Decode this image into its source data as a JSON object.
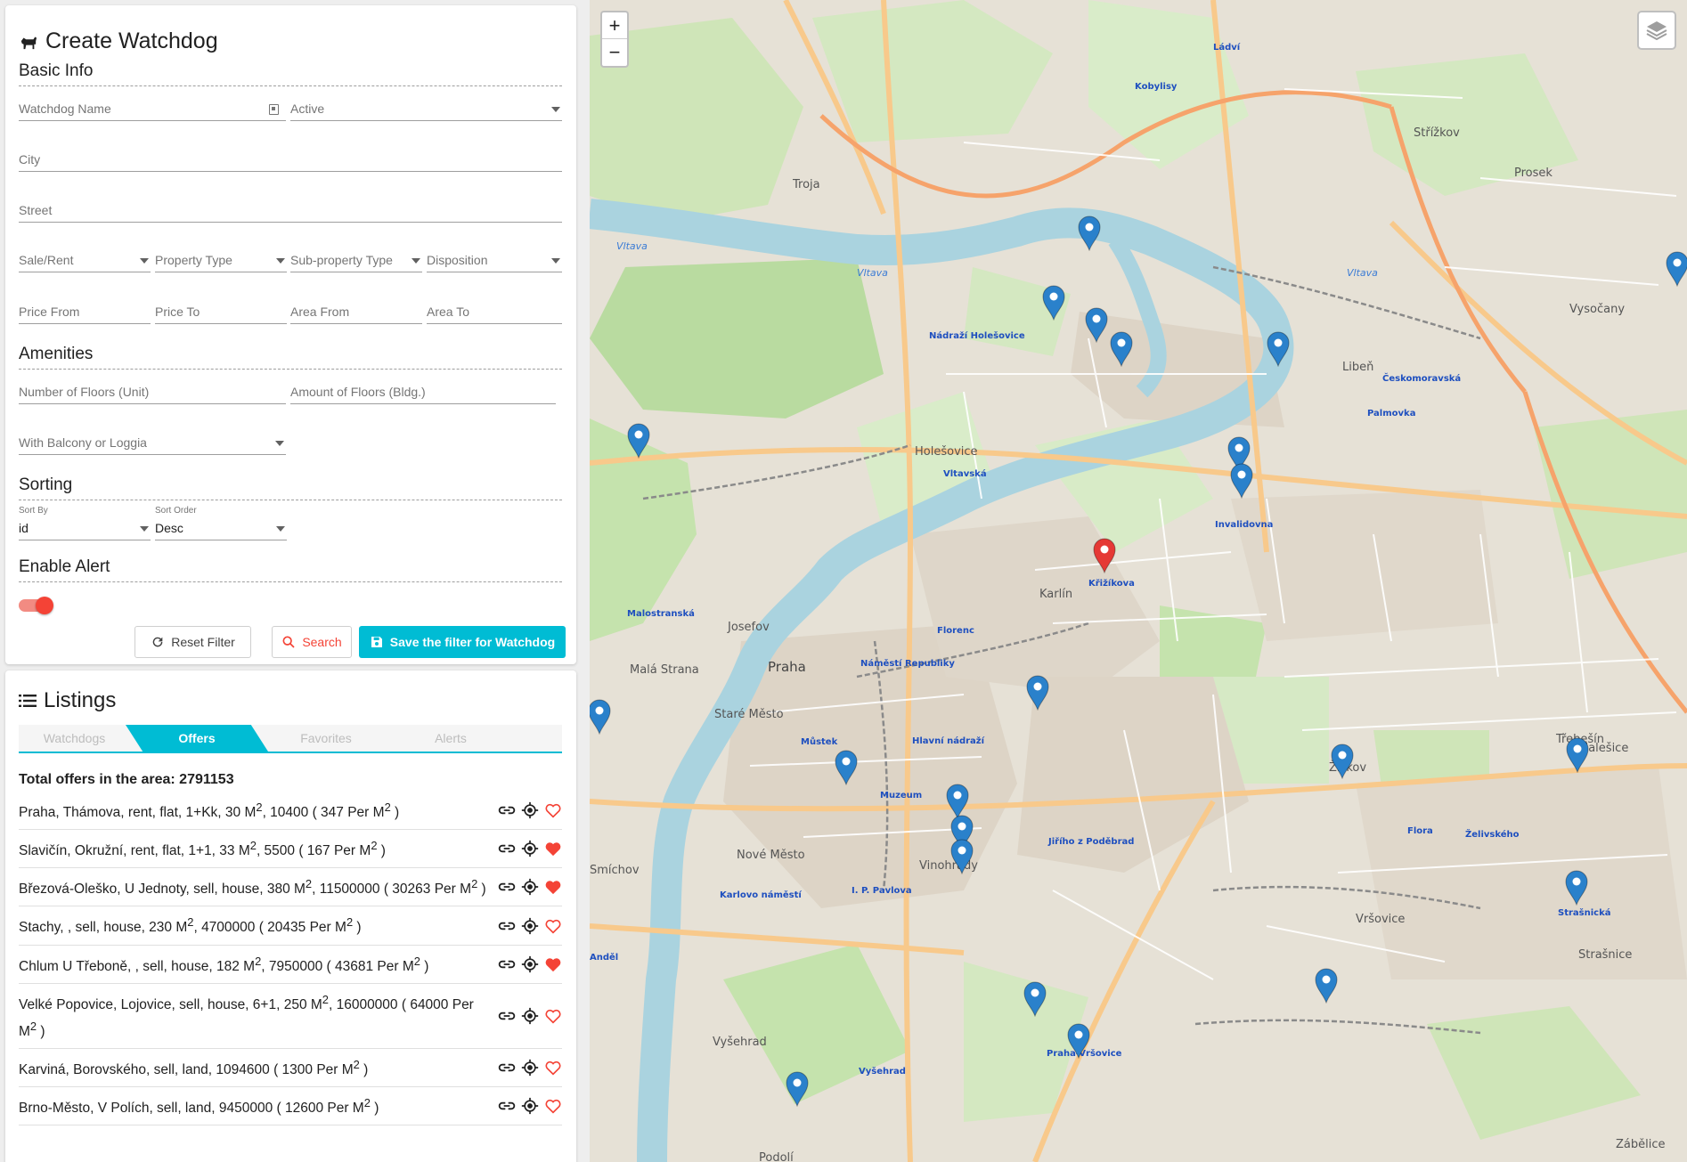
{
  "create": {
    "title": "Create Watchdog",
    "basic_info": "Basic Info",
    "watchdog_name_placeholder": "Watchdog Name",
    "active_placeholder": "Active",
    "city_placeholder": "City",
    "street_placeholder": "Street",
    "sale_rent": "Sale/Rent",
    "property_type": "Property Type",
    "sub_property_type": "Sub-property Type",
    "disposition": "Disposition",
    "price_from": "Price From",
    "price_to": "Price To",
    "area_from": "Area From",
    "area_to": "Area To",
    "amenities": "Amenities",
    "floors_unit": "Number of Floors (Unit)",
    "floors_bldg": "Amount of Floors (Bldg.)",
    "balcony": "With Balcony or Loggia",
    "sorting": "Sorting",
    "sort_by_label": "Sort By",
    "sort_by_value": "id",
    "sort_order_label": "Sort Order",
    "sort_order_value": "Desc",
    "enable_alert": "Enable Alert",
    "alert_enabled": true,
    "reset_label": "Reset Filter",
    "search_label": "Search",
    "save_label": "Save the filter for Watchdog"
  },
  "listings": {
    "title": "Listings",
    "tabs": [
      "Watchdogs",
      "Offers",
      "Favorites",
      "Alerts"
    ],
    "active_tab": "Offers",
    "total": "Total offers in the area: 2791153",
    "items": [
      {
        "text_html": "Praha, Thámova, rent, flat, 1+Kk, 30 M<sup>2</sup>, 10400 ( 347 Per M<sup>2</sup> )",
        "text": "Praha, Thámova, rent, flat, 1+Kk, 30 M2, 10400 ( 347 Per M2 )",
        "favorite": false
      },
      {
        "text_html": "Slavičín, Okružní, rent, flat, 1+1, 33 M<sup>2</sup>, 5500 ( 167 Per M<sup>2</sup> )",
        "text": "Slavičín, Okružní, rent, flat, 1+1, 33 M2, 5500 ( 167 Per M2 )",
        "favorite": true
      },
      {
        "text_html": "Březová-Oleško, U Jednoty, sell, house, 380 M<sup>2</sup>, 11500000 ( 30263 Per M<sup>2</sup> )",
        "text": "Březová-Oleško, U Jednoty, sell, house, 380 M2, 11500000 ( 30263 Per M2 )",
        "favorite": true
      },
      {
        "text_html": "Stachy, , sell, house, 230 M<sup>2</sup>, 4700000 ( 20435 Per M<sup>2</sup> )",
        "text": "Stachy, , sell, house, 230 M2, 4700000 ( 20435 Per M2 )",
        "favorite": false
      },
      {
        "text_html": "Chlum U Třeboně, , sell, house, 182 M<sup>2</sup>, 7950000 ( 43681 Per M<sup>2</sup> )",
        "text": "Chlum U Třeboně, , sell, house, 182 M2, 7950000 ( 43681 Per M2 )",
        "favorite": true
      },
      {
        "text_html": "Velké Popovice, Lojovice, sell, house, 6+1, 250 M<sup>2</sup>, 16000000 ( 64000 Per M<sup>2</sup> )",
        "text": "Velké Popovice, Lojovice, sell, house, 6+1, 250 M2, 16000000 ( 64000 Per M2 )",
        "favorite": false
      },
      {
        "text_html": "Karviná, Borovského, sell, land, 1094600 ( 1300 Per M<sup>2</sup> )",
        "text": "Karviná, Borovského, sell, land, 1094600 ( 1300 Per M2 )",
        "favorite": false
      },
      {
        "text_html": "Brno-Město, V Polích, sell, land, 9450000 ( 12600 Per M<sup>2</sup> )",
        "text": "Brno-Město, V Polích, sell, land, 9450000 ( 12600 Per M2 )",
        "favorite": false
      }
    ]
  },
  "map": {
    "zoom_in": "+",
    "zoom_out": "−",
    "accent": "#00bcd4",
    "marker_color": "#2a81cb",
    "selected_marker_color": "#e53935",
    "labels": [
      {
        "t": "Praha",
        "cls": "big"
      },
      {
        "t": "Karlín",
        "cls": "district"
      },
      {
        "t": "Holešovice",
        "cls": "district"
      },
      {
        "t": "Žižkov",
        "cls": "district"
      },
      {
        "t": "Libeň",
        "cls": "district"
      },
      {
        "t": "Troja",
        "cls": "district"
      },
      {
        "t": "Vršovice",
        "cls": "district"
      },
      {
        "t": "Vinohrady",
        "cls": "district"
      },
      {
        "t": "Nové Město",
        "cls": "district"
      },
      {
        "t": "Staré Město",
        "cls": "district"
      },
      {
        "t": "Malá Strana",
        "cls": "district"
      },
      {
        "t": "Josefov",
        "cls": "district"
      },
      {
        "t": "Vyšehrad",
        "cls": "district"
      },
      {
        "t": "Střížkov",
        "cls": "district"
      },
      {
        "t": "Prosek",
        "cls": "district"
      },
      {
        "t": "Vysočany",
        "cls": "district"
      },
      {
        "t": "Malešice",
        "cls": "district"
      },
      {
        "t": "Strašnice",
        "cls": "district"
      },
      {
        "t": "Třebešín",
        "cls": "district"
      },
      {
        "t": "Smíchov",
        "cls": "district"
      },
      {
        "t": "Zábělice",
        "cls": "district"
      },
      {
        "t": "Podolí",
        "cls": "district"
      },
      {
        "t": "Vltava",
        "cls": "river"
      },
      {
        "t": "Vltava",
        "cls": "river"
      },
      {
        "t": "Vltava",
        "cls": "river"
      },
      {
        "t": "Křižíkova",
        "cls": "station"
      },
      {
        "t": "Florenc",
        "cls": "station"
      },
      {
        "t": "Invalidovna",
        "cls": "station"
      },
      {
        "t": "Palmovka",
        "cls": "station"
      },
      {
        "t": "Nádraží Holešovice",
        "cls": "station"
      },
      {
        "t": "Vltavská",
        "cls": "station"
      },
      {
        "t": "Můstek",
        "cls": "station"
      },
      {
        "t": "Muzeum",
        "cls": "station"
      },
      {
        "t": "Flora",
        "cls": "station"
      },
      {
        "t": "Želivského",
        "cls": "station"
      },
      {
        "t": "Strašnická",
        "cls": "station"
      },
      {
        "t": "Náměstí Republiky",
        "cls": "station"
      },
      {
        "t": "Hlavní nádraží",
        "cls": "station"
      },
      {
        "t": "Jiřího z Poděbrad",
        "cls": "station"
      },
      {
        "t": "Praha-Vršovice",
        "cls": "station"
      },
      {
        "t": "Vyšehrad",
        "cls": "station"
      },
      {
        "t": "Kobylisy",
        "cls": "station"
      },
      {
        "t": "Ládví",
        "cls": "station"
      },
      {
        "t": "Českomoravská",
        "cls": "station"
      },
      {
        "t": "Malostranská",
        "cls": "station"
      },
      {
        "t": "I. P. Pavlova",
        "cls": "station"
      },
      {
        "t": "Karlovo náměstí",
        "cls": "station"
      },
      {
        "t": "Anděl",
        "cls": "station"
      }
    ]
  }
}
